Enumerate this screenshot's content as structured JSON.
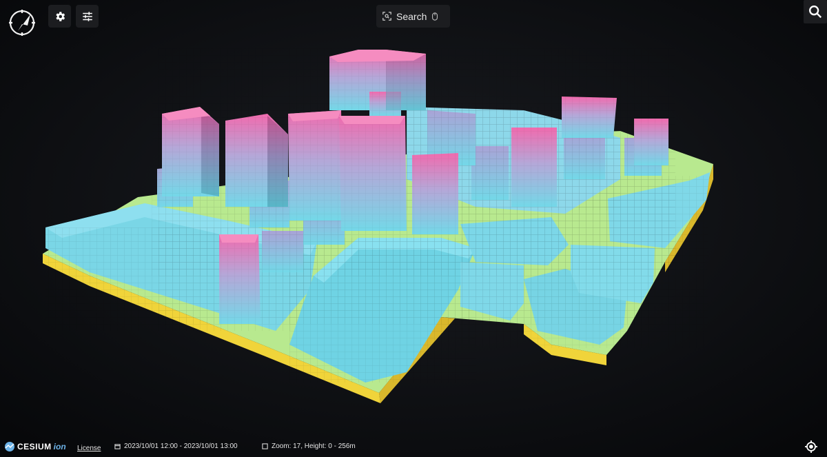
{
  "toolbar": {
    "compass_icon": "compass-icon",
    "settings_icon": "gear-icon",
    "filters_icon": "sliders-icon",
    "search_label": "Search",
    "search_icon": "search-box-icon",
    "mouse_icon": "mouse-icon",
    "zoom_icon": "magnifier-icon"
  },
  "map": {
    "type": "3D voxel city view",
    "colors": [
      "#f47bb6",
      "#6ed8e8",
      "#9cc7ec",
      "#a8d7f2",
      "#f1dd4a",
      "#a7ef9d"
    ]
  },
  "footer": {
    "brand": "CESIUM",
    "brand_suffix": "ion",
    "license_label": "License",
    "time_range": "2023/10/01 12:00 - 2023/10/01 13:00",
    "zoom_height": "Zoom: 17, Height: 0 - 256m",
    "calendar_icon": "calendar-icon",
    "square_icon": "square-icon",
    "locate_icon": "crosshair-icon"
  }
}
